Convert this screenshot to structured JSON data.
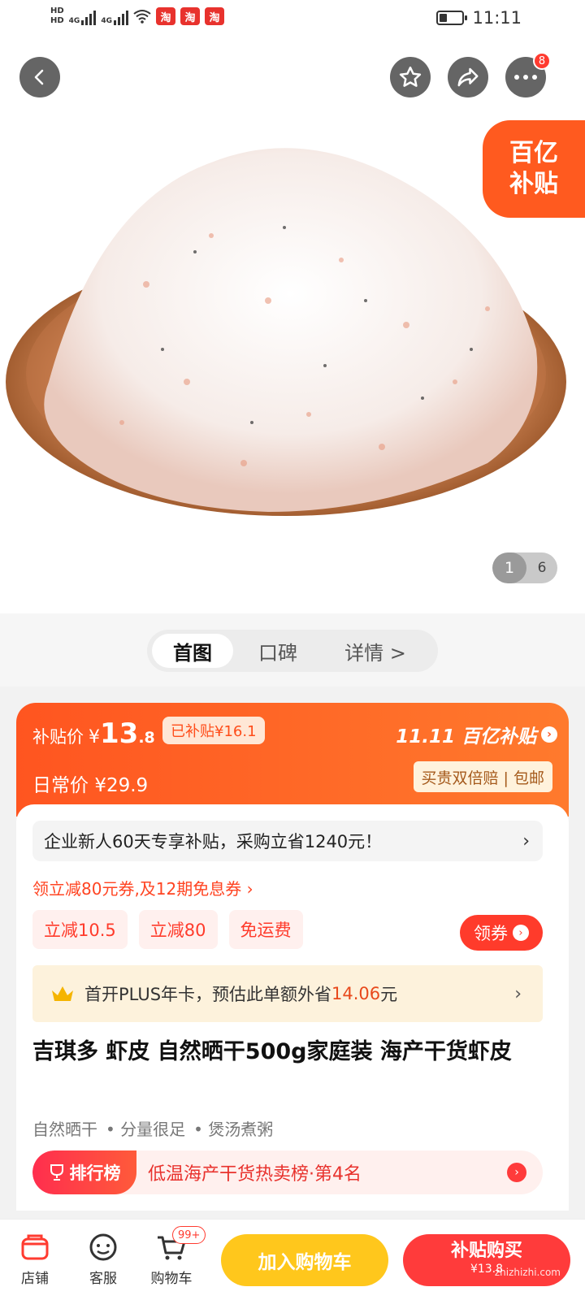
{
  "status_bar": {
    "hd1": "HD",
    "hd2": "HD",
    "net1": "4G",
    "net2": "4G",
    "app_icon": "淘",
    "time": "11:11"
  },
  "header": {
    "back_icon": "chevron-left-icon",
    "fav_icon": "star-icon",
    "share_icon": "share-icon",
    "more_icon": "more-icon",
    "more_badge": "8"
  },
  "hero": {
    "subsidy_line1": "百亿",
    "subsidy_line2": "补贴",
    "image_index": "1",
    "image_total": "6"
  },
  "tabs": [
    {
      "label": "首图"
    },
    {
      "label": "口碑"
    },
    {
      "label": "详情 >"
    }
  ],
  "price": {
    "label": "补贴价",
    "yen": "¥",
    "big": "13",
    "small": ".8",
    "already": "已补贴¥16.1",
    "regular_label": "日常价",
    "regular_price": "¥29.9",
    "brand": "11.11 百亿补贴",
    "brand_arrow": "›",
    "guarantee": "买贵双倍赔 | 包邮"
  },
  "info": {
    "enterprise": "企业新人60天专享补贴，采购立省1240元！",
    "enterprise_chev": "›",
    "coupon_line": "领立减80元券,及12期免息券 ›",
    "chips": [
      {
        "label": "立减10.5"
      },
      {
        "label": "立减80"
      },
      {
        "label": "免运费"
      }
    ],
    "get_coupon": "领券",
    "get_coupon_arrow": "›",
    "plus_prefix": "首开PLUS年卡，预估此单额外省",
    "plus_amount": "14.06",
    "plus_suffix": "元",
    "plus_chev": "›",
    "title": "吉琪多 虾皮 自然晒干500g家庭装 海产干货虾皮",
    "features": [
      "自然晒干",
      "• 分量很足",
      "• 煲汤煮粥"
    ],
    "rank_tag": "排行榜",
    "rank_text": "低温海产干货热卖榜·第4名",
    "rank_arrow": "›"
  },
  "bottom_bar": {
    "shop": "店铺",
    "service": "客服",
    "cart": "购物车",
    "cart_badge": "99+",
    "add_cart": "加入购物车",
    "buy_now": "补贴购买",
    "buy_price": "¥13.8",
    "watermark": "zhizhizhi.com"
  },
  "colors": {
    "accent": "#ff5520",
    "red": "#ff3b3b",
    "yellow": "#ffc71c"
  }
}
